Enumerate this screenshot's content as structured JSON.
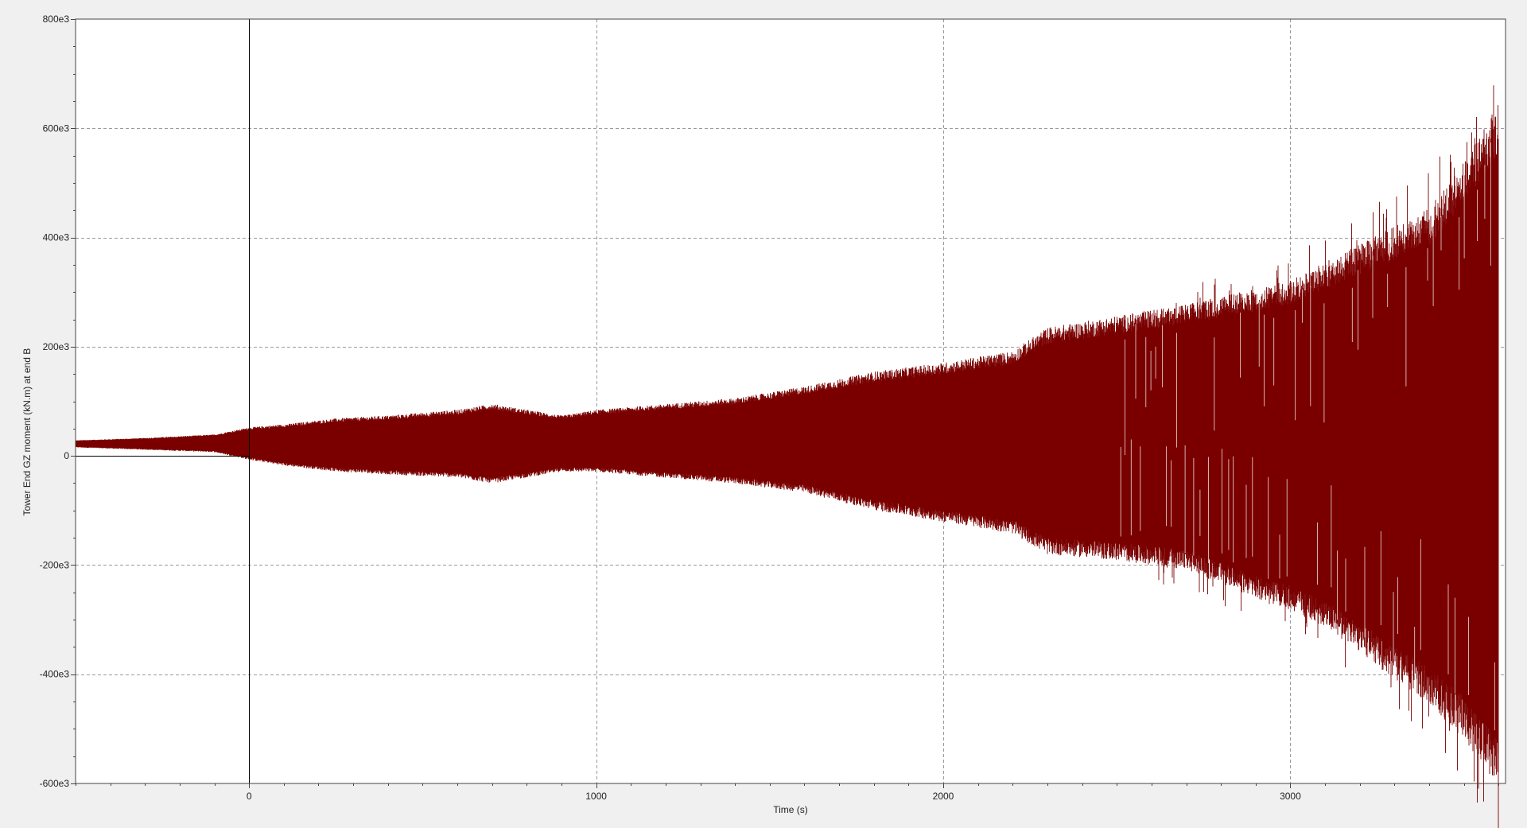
{
  "chart_data": {
    "type": "area",
    "xlabel": "Time (s)",
    "ylabel": "Tower End GZ moment (kN.m) at end B",
    "xlim": [
      -500,
      3620
    ],
    "ylim": [
      -600000,
      800000
    ],
    "xticks": [
      0,
      1000,
      2000,
      3000
    ],
    "xtick_labels": [
      "0",
      "1000",
      "2000",
      "3000"
    ],
    "yticks": [
      -600000,
      -400000,
      -200000,
      0,
      200000,
      400000,
      600000,
      800000
    ],
    "ytick_labels": [
      "-600e3",
      "-400e3",
      "-200e3",
      "0",
      "200e3",
      "400e3",
      "600e3",
      "800e3"
    ],
    "grid": true,
    "grid_style": "dashed",
    "background": "#f0f0f0",
    "plot_background": "#ffffff",
    "series": [
      {
        "color": "#7a0000",
        "x": [
          -500,
          -300,
          -100,
          0,
          100,
          250,
          400,
          600,
          700,
          900,
          1000,
          1200,
          1400,
          1600,
          1800,
          2000,
          2200,
          2300,
          2500,
          2700,
          2900,
          3000,
          3100,
          3200,
          3300,
          3400,
          3500,
          3600
        ],
        "upper": [
          28000,
          32000,
          38000,
          50000,
          55000,
          65000,
          70000,
          80000,
          90000,
          70000,
          80000,
          90000,
          100000,
          120000,
          145000,
          160000,
          180000,
          220000,
          240000,
          260000,
          285000,
          300000,
          330000,
          360000,
          390000,
          420000,
          500000,
          600000
        ],
        "lower": [
          16000,
          12000,
          8000,
          -5000,
          -15000,
          -25000,
          -30000,
          -35000,
          -45000,
          -25000,
          -25000,
          -35000,
          -45000,
          -60000,
          -90000,
          -110000,
          -130000,
          -165000,
          -175000,
          -190000,
          -240000,
          -260000,
          -290000,
          -330000,
          -380000,
          -420000,
          -480000,
          -560000
        ]
      }
    ]
  }
}
